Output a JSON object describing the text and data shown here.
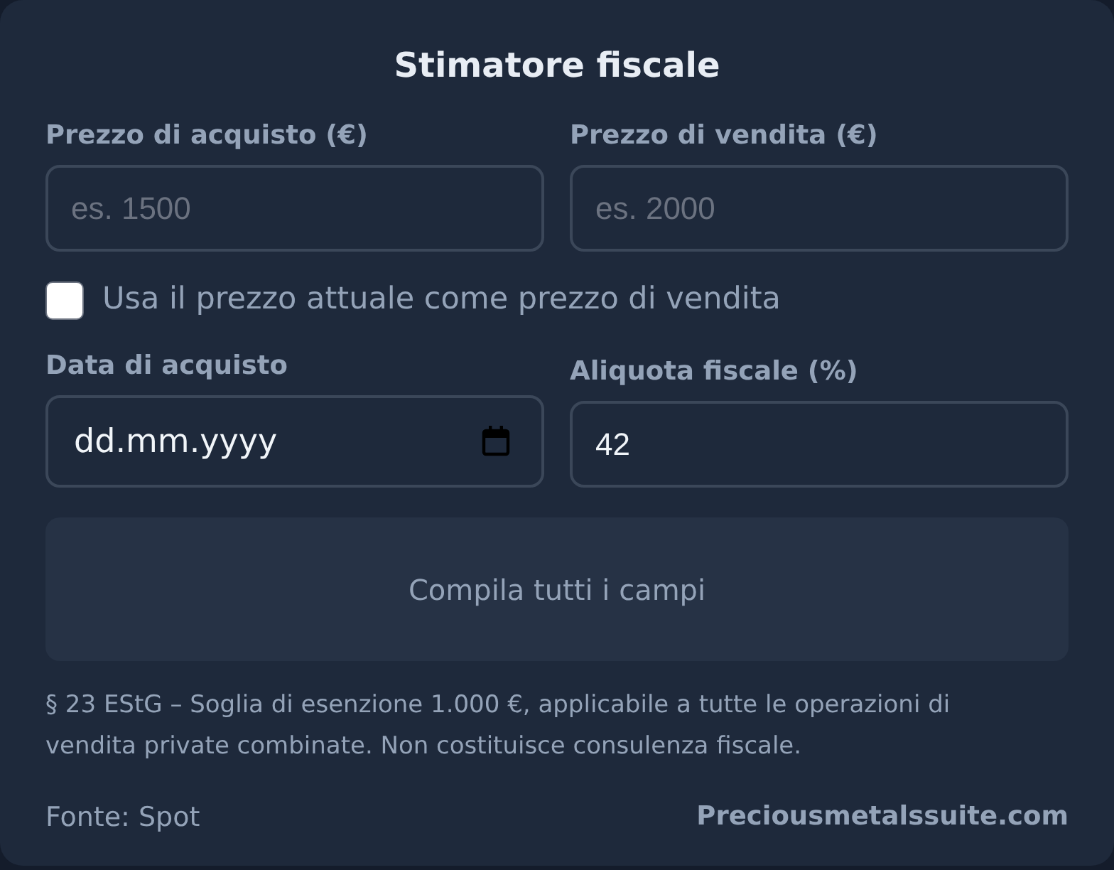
{
  "title": "Stimatore fiscale",
  "price_fields": [
    {
      "kind": "text",
      "label": "Prezzo di acquisto (€)",
      "placeholder": "es. 1500"
    },
    {
      "kind": "text",
      "label": "Prezzo di vendita (€)",
      "placeholder": "es. 2000"
    }
  ],
  "use_current_price": {
    "label": "Usa il prezzo attuale come prezzo di vendita",
    "checked": false
  },
  "detail_fields": [
    {
      "kind": "date",
      "label": "Data di acquisto",
      "placeholder": "dd.mm.yyyy"
    },
    {
      "kind": "number",
      "label": "Aliquota fiscale (%)",
      "value": "42"
    }
  ],
  "result": {
    "message": "Compila tutti i campi"
  },
  "disclaimer": "§ 23 EStG – Soglia di esenzione 1.000 €, applicabile a tutte le operazioni di vendita private combinate. Non costituisce consulenza fiscale.",
  "footer": {
    "source": "Fonte: Spot",
    "link": "Preciousmetalssuite.com"
  }
}
